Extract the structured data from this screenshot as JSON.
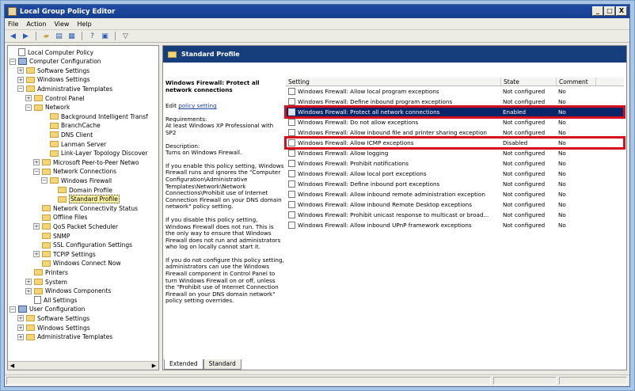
{
  "window": {
    "title": "Local Group Policy Editor",
    "controls": [
      "_",
      "□",
      "X"
    ]
  },
  "menu": [
    "File",
    "Action",
    "View",
    "Help"
  ],
  "toolbar": {
    "icons": [
      "back-icon",
      "forward-icon",
      "up-folder-icon",
      "show-hide-tree-icon",
      "export-list-icon",
      "help-icon",
      "properties-icon",
      "filter-icon"
    ]
  },
  "tree": {
    "rows": [
      {
        "label": "Local Computer Policy",
        "exp": "",
        "icon": "doc"
      },
      {
        "label": "Computer Configuration",
        "exp": "−",
        "icon": "pc"
      },
      {
        "label": "Software Settings",
        "exp": "+",
        "icon": "folder"
      },
      {
        "label": "Windows Settings",
        "exp": "+",
        "icon": "folder"
      },
      {
        "label": "Administrative Templates",
        "exp": "−",
        "icon": "folder"
      },
      {
        "label": "Control Panel",
        "exp": "+",
        "icon": "folder"
      },
      {
        "label": "Network",
        "exp": "−",
        "icon": "folder"
      },
      {
        "label": "Background Intelligent Transf",
        "exp": "",
        "icon": "folder"
      },
      {
        "label": "BranchCache",
        "exp": "",
        "icon": "folder"
      },
      {
        "label": "DNS Client",
        "exp": "",
        "icon": "folder"
      },
      {
        "label": "Lanman Server",
        "exp": "",
        "icon": "folder"
      },
      {
        "label": "Link-Layer Topology Discover",
        "exp": "",
        "icon": "folder"
      },
      {
        "label": "Microsoft Peer-to-Peer Netwo",
        "exp": "+",
        "icon": "folder"
      },
      {
        "label": "Network Connections",
        "exp": "−",
        "icon": "folder"
      },
      {
        "label": "Windows Firewall",
        "exp": "−",
        "icon": "folder"
      },
      {
        "label": "Domain Profile",
        "exp": "",
        "icon": "folder"
      },
      {
        "label": "Standard Profile",
        "exp": "",
        "icon": "folder",
        "selected": true
      },
      {
        "label": "Network Connectivity Status",
        "exp": "",
        "icon": "folder"
      },
      {
        "label": "Offline Files",
        "exp": "",
        "icon": "folder"
      },
      {
        "label": "QoS Packet Scheduler",
        "exp": "+",
        "icon": "folder"
      },
      {
        "label": "SNMP",
        "exp": "",
        "icon": "folder"
      },
      {
        "label": "SSL Configuration Settings",
        "exp": "",
        "icon": "folder"
      },
      {
        "label": "TCPIP Settings",
        "exp": "+",
        "icon": "folder"
      },
      {
        "label": "Windows Connect Now",
        "exp": "",
        "icon": "folder"
      },
      {
        "label": "Printers",
        "exp": "",
        "icon": "folder"
      },
      {
        "label": "System",
        "exp": "+",
        "icon": "folder"
      },
      {
        "label": "Windows Components",
        "exp": "+",
        "icon": "folder"
      },
      {
        "label": "All Settings",
        "exp": "",
        "icon": "doc"
      },
      {
        "label": "User Configuration",
        "exp": "−",
        "icon": "pc"
      },
      {
        "label": "Software Settings",
        "exp": "+",
        "icon": "folder"
      },
      {
        "label": "Windows Settings",
        "exp": "+",
        "icon": "folder"
      },
      {
        "label": "Administrative Templates",
        "exp": "+",
        "icon": "folder"
      }
    ]
  },
  "panel": {
    "header": "Standard Profile",
    "description": {
      "title": "Windows Firewall: Protect all network connections",
      "edit_prefix": "Edit ",
      "edit_link": "policy setting",
      "requirements": "Requirements:\nAt least Windows XP Professional with SP2",
      "description": "Description:\nTurns on Windows Firewall.",
      "p1": "If you enable this policy setting, Windows Firewall runs and ignores the \"Computer Configuration\\Administrative Templates\\Network\\Network Connections\\Prohibit use of Internet Connection Firewall on your DNS domain network\" policy setting.",
      "p2": "If you disable this policy setting, Windows Firewall does not run. This is the only way to ensure that Windows Firewall does not run and administrators who log on locally cannot start it.",
      "p3": "If you do not configure this policy setting, administrators can use the Windows Firewall component in Control Panel to turn Windows Firewall on or off, unless the \"Prohibit use of Internet Connection Firewall on your DNS domain network\" policy setting overrides."
    },
    "columns": [
      "Setting",
      "State",
      "Comment"
    ],
    "rows": [
      {
        "setting": "Windows Firewall: Allow local program exceptions",
        "state": "Not configured",
        "comment": "No"
      },
      {
        "setting": "Windows Firewall: Define inbound program exceptions",
        "state": "Not configured",
        "comment": "No"
      },
      {
        "setting": "Windows Firewall: Protect all network connections",
        "state": "Enabled",
        "comment": "No",
        "selected": true,
        "highlighted": true
      },
      {
        "setting": "Windows Firewall: Do not allow exceptions",
        "state": "Not configured",
        "comment": "No"
      },
      {
        "setting": "Windows Firewall: Allow inbound file and printer sharing exception",
        "state": "Not configured",
        "comment": "No"
      },
      {
        "setting": "Windows Firewall: Allow ICMP exceptions",
        "state": "Disabled",
        "comment": "No",
        "highlighted": true
      },
      {
        "setting": "Windows Firewall: Allow logging",
        "state": "Not configured",
        "comment": "No"
      },
      {
        "setting": "Windows Firewall: Prohibit notifications",
        "state": "Not configured",
        "comment": "No"
      },
      {
        "setting": "Windows Firewall: Allow local port exceptions",
        "state": "Not configured",
        "comment": "No"
      },
      {
        "setting": "Windows Firewall: Define inbound port exceptions",
        "state": "Not configured",
        "comment": "No"
      },
      {
        "setting": "Windows Firewall: Allow inbound remote administration exception",
        "state": "Not configured",
        "comment": "No"
      },
      {
        "setting": "Windows Firewall: Allow inbound Remote Desktop exceptions",
        "state": "Not configured",
        "comment": "No"
      },
      {
        "setting": "Windows Firewall: Prohibit unicast response to multicast or broad...",
        "state": "Not configured",
        "comment": "No"
      },
      {
        "setting": "Windows Firewall: Allow inbound UPnP framework exceptions",
        "state": "Not configured",
        "comment": "No"
      }
    ],
    "tabs": [
      "Extended",
      "Standard"
    ]
  },
  "colors": {
    "highlight": "#d8101e",
    "selection": "#0a246a",
    "header_bar": "#163e7d"
  }
}
